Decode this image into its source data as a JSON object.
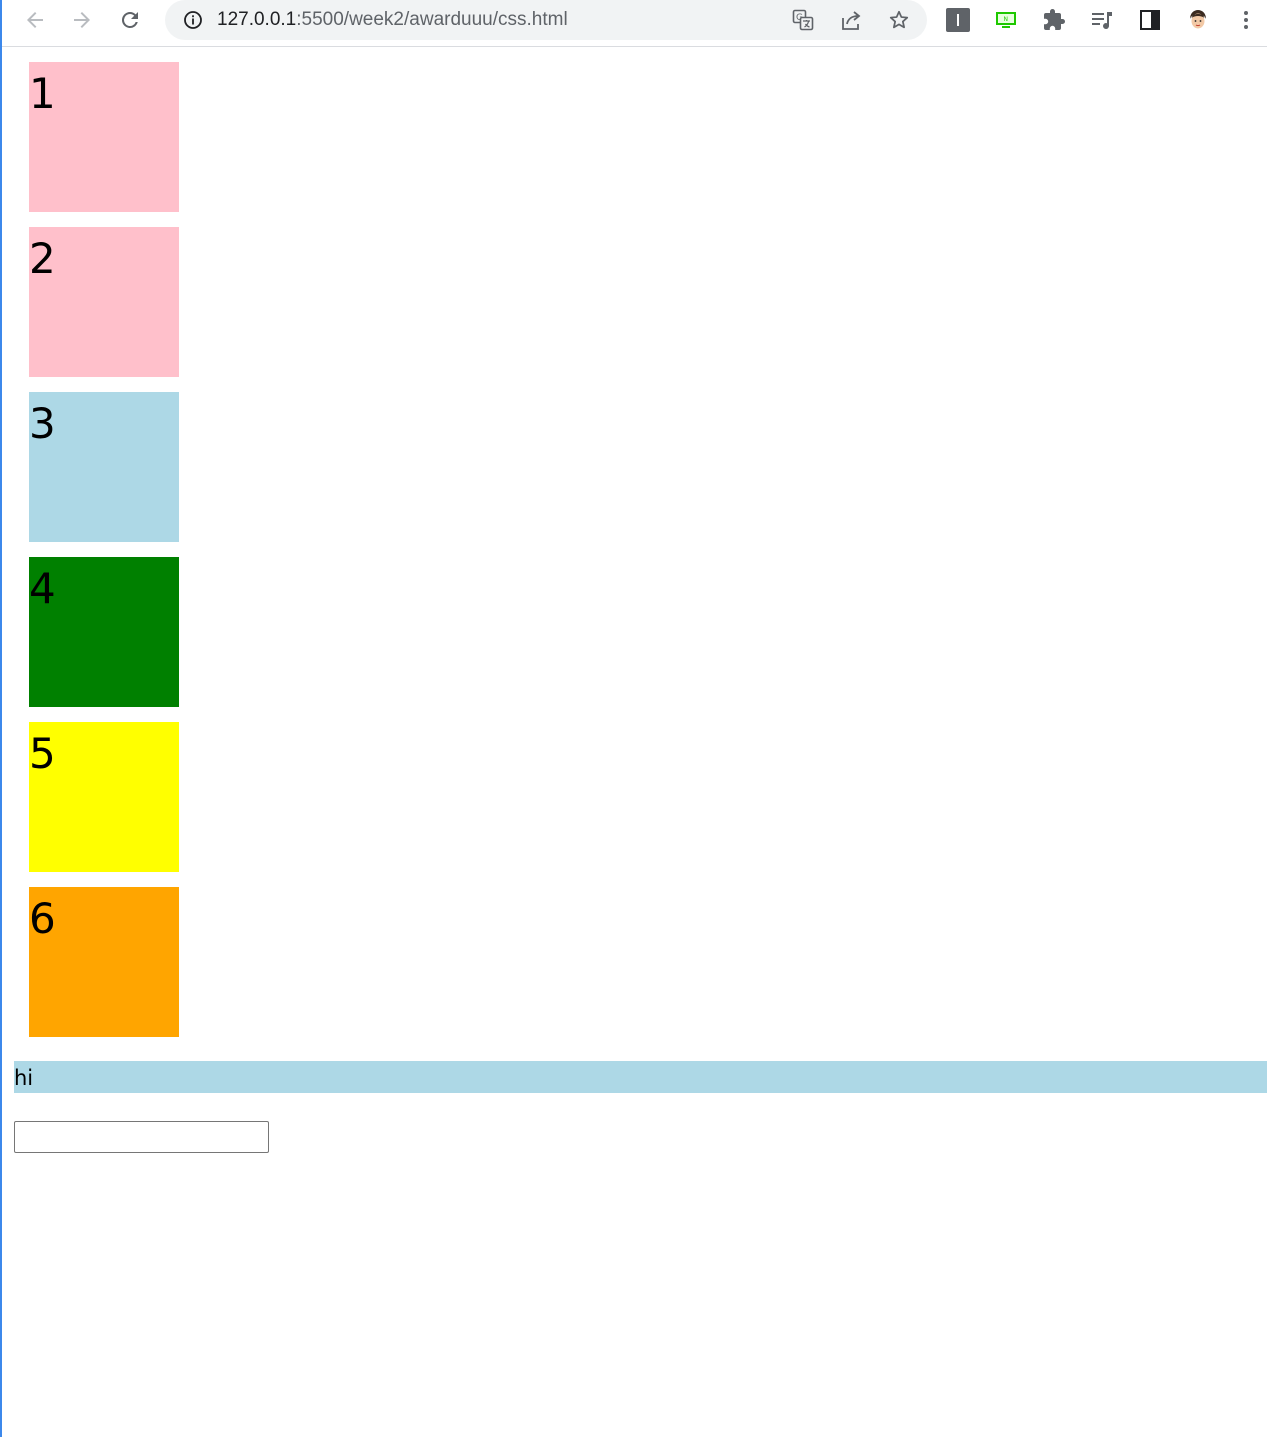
{
  "browser": {
    "url_host": "127.0.0.1",
    "url_rest": ":5500/week2/awarduuu/css.html",
    "icons": {
      "back": "arrow-left-icon",
      "forward": "arrow-right-icon",
      "reload": "reload-icon",
      "site_info": "info-icon",
      "translate": "translate-icon",
      "share": "share-icon",
      "bookmark": "star-icon",
      "extension_1": "extension-i-icon",
      "extension_2": "extension-green-icon",
      "extensions": "puzzle-icon",
      "reading_list": "media-queue-icon",
      "side_panel": "side-panel-icon",
      "profile": "avatar-icon",
      "menu": "kebab-menu-icon"
    }
  },
  "page": {
    "boxes": [
      {
        "label": "1",
        "color": "#ffc0cb"
      },
      {
        "label": "2",
        "color": "#ffc0cb"
      },
      {
        "label": "3",
        "color": "#add8e6"
      },
      {
        "label": "4",
        "color": "#008000"
      },
      {
        "label": "5",
        "color": "#ffff00"
      },
      {
        "label": "6",
        "color": "#ffa500"
      }
    ],
    "hi_text": "hi",
    "hi_color": "#add8e6",
    "input_value": ""
  }
}
